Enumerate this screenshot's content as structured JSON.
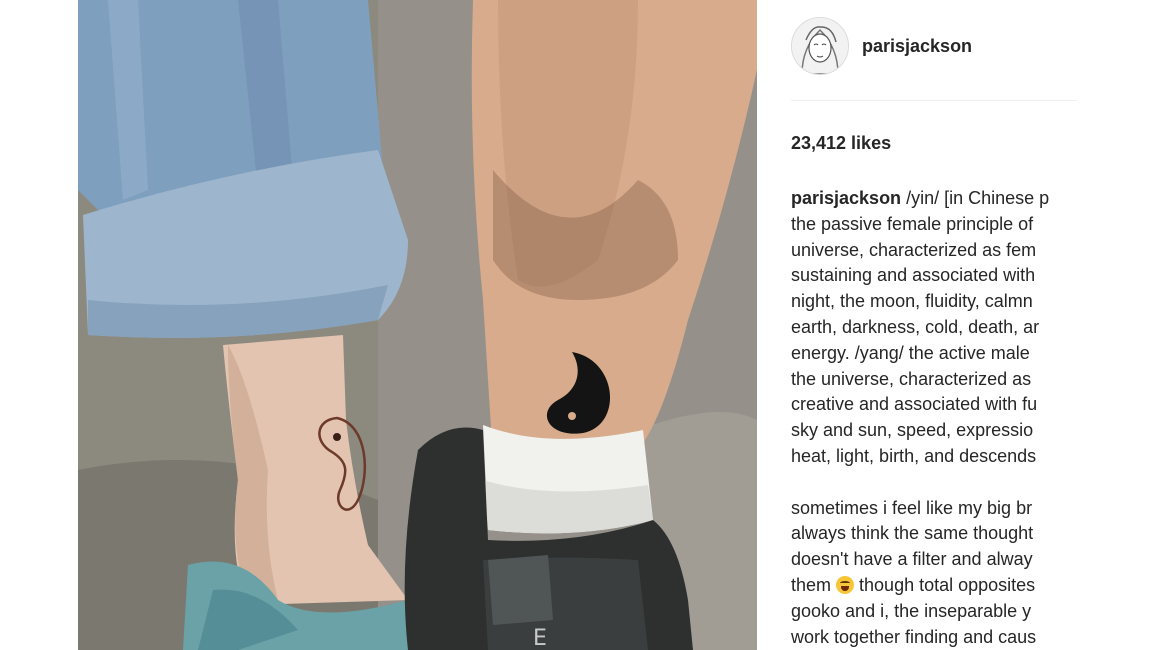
{
  "post": {
    "image_alt": "",
    "author": "parisjackson",
    "likes": "23,412 likes",
    "caption_author": "parisjackson",
    "caption_first_line": " /yin/ [in Chinese p",
    "caption_lines": [
      "the passive female principle of",
      "universe, characterized as fem",
      "sustaining and associated with",
      "night, the moon, fluidity, calmn",
      "earth, darkness, cold, death, ar",
      "energy. /yang/ the active male",
      "the universe, characterized as",
      "creative and associated with fu",
      "sky and sun, speed, expressio",
      "heat, light, birth, and descends"
    ],
    "caption_lines_2a": [
      "sometimes i feel like my big br",
      "always think the same thought",
      "doesn't have a filter and alway"
    ],
    "caption_emoji_line_before": "them ",
    "caption_emoji_line_after": " though total opposites",
    "caption_lines_2b": [
      "gooko and i, the inseparable y",
      "work together finding and caus"
    ],
    "emoji_icon": "face-with-tears-of-joy-icon"
  },
  "colors": {
    "text": "#262626",
    "divider": "#efefef",
    "background": "#ffffff"
  }
}
